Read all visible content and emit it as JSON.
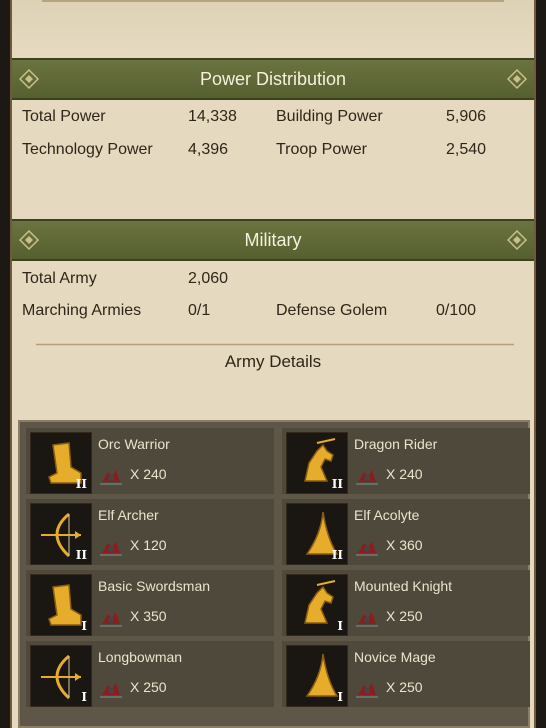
{
  "power": {
    "title": "Power Distribution",
    "total_power_label": "Total Power",
    "total_power_value": "14,338",
    "building_power_label": "Building Power",
    "building_power_value": "5,906",
    "technology_power_label": "Technology Power",
    "technology_power_value": "4,396",
    "troop_power_label": "Troop Power",
    "troop_power_value": "2,540"
  },
  "military": {
    "title": "Military",
    "total_army_label": "Total Army",
    "total_army_value": "2,060",
    "marching_label": "Marching Armies",
    "marching_value": "0/1",
    "golem_label": "Defense Golem",
    "golem_value": "0/100"
  },
  "army_details": {
    "title": "Army Details",
    "units": [
      {
        "name": "Orc Warrior",
        "count": "X 240",
        "rank": "II",
        "icon": "boot-icon"
      },
      {
        "name": "Dragon Rider",
        "count": "X 240",
        "rank": "II",
        "icon": "horse-icon"
      },
      {
        "name": "Elf Archer",
        "count": "X 120",
        "rank": "II",
        "icon": "bow-icon"
      },
      {
        "name": "Elf Acolyte",
        "count": "X 360",
        "rank": "II",
        "icon": "mage-hat-icon"
      },
      {
        "name": "Basic Swordsman",
        "count": "X 350",
        "rank": "I",
        "icon": "boot-icon"
      },
      {
        "name": "Mounted Knight",
        "count": "X 250",
        "rank": "I",
        "icon": "horse-icon"
      },
      {
        "name": "Longbowman",
        "count": "X 250",
        "rank": "I",
        "icon": "bow-icon"
      },
      {
        "name": "Novice Mage",
        "count": "X 250",
        "rank": "I",
        "icon": "mage-hat-icon"
      }
    ]
  },
  "colors": {
    "header_green": "#5f6936",
    "parchment": "#e5d9bf",
    "panel": "#5e5747",
    "gold": "#e0a82a"
  }
}
